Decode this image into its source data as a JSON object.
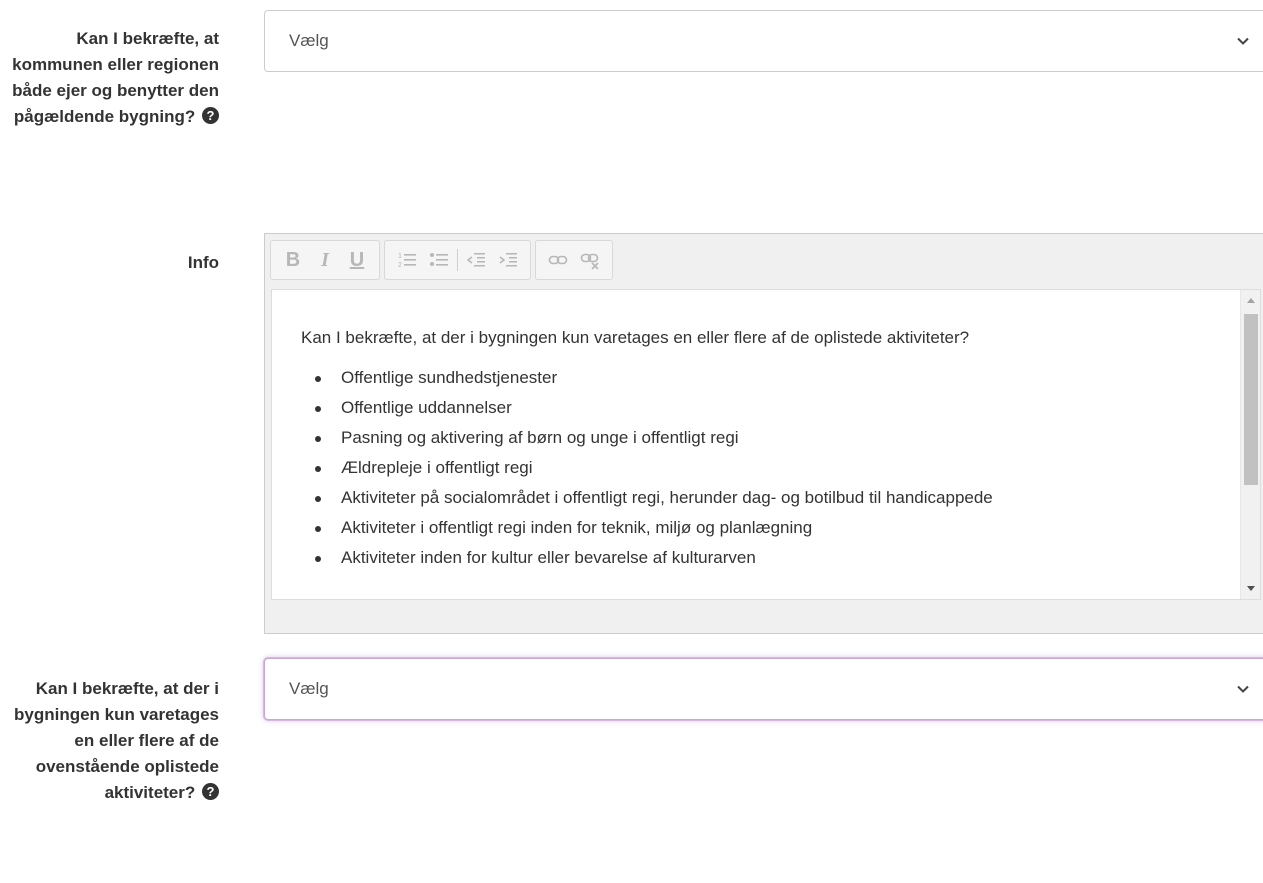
{
  "question1": {
    "label": "Kan I bekræfte, at kommunen eller regionen både ejer og benytter den pågældende bygning?",
    "select_value": "Vælg"
  },
  "info": {
    "label": "Info",
    "toolbar": {
      "bold": "B",
      "italic": "I",
      "underline": "U",
      "icons": [
        "ordered-list-icon",
        "unordered-list-icon",
        "outdent-icon",
        "indent-icon",
        "link-icon",
        "unlink-icon"
      ]
    },
    "content": {
      "paragraph": "Kan I bekræfte, at der i bygningen kun varetages en eller flere af de oplistede aktiviteter?",
      "items": [
        "Offentlige sundhedstjenester",
        "Offentlige uddannelser",
        "Pasning og aktivering af børn og unge i offentligt regi",
        "Ældrepleje i offentligt regi",
        "Aktiviteter på socialområdet i offentligt regi, herunder dag- og botilbud til handicappede",
        "Aktiviteter i offentligt regi inden for teknik, miljø og planlægning",
        "Aktiviteter inden for kultur eller bevarelse af kulturarven"
      ]
    }
  },
  "question2": {
    "label": "Kan I bekræfte, at der i bygningen kun varetages en eller flere af de ovenstående oplistede aktiviteter?",
    "select_value": "Vælg"
  },
  "colors": {
    "label_text": "#333333",
    "select_border": "#cccccc",
    "focus_glow": "#c9a8d6",
    "toolbar_icon": "#b7b7b7",
    "editor_bg": "#f0f0f0"
  }
}
